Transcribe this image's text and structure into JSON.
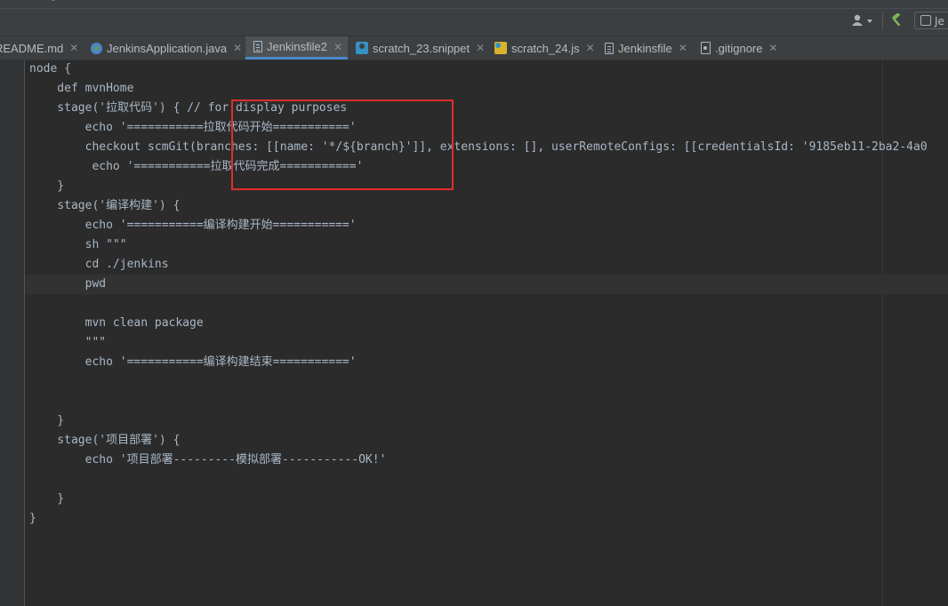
{
  "toolbar": {
    "user_icon": "user-icon",
    "build_icon": "hammer-icon",
    "run_config_label": "Je"
  },
  "tabs": [
    {
      "label": "README.md",
      "icon": "file-icon",
      "active": false
    },
    {
      "label": "JenkinsApplication.java",
      "icon": "spring-class-icon",
      "active": false
    },
    {
      "label": "Jenkinsfile2",
      "icon": "file-icon",
      "active": true
    },
    {
      "label": "scratch_23.snippet",
      "icon": "scratch-icon",
      "active": false
    },
    {
      "label": "scratch_24.js",
      "icon": "js-scratch-icon",
      "active": false
    },
    {
      "label": "Jenkinsfile",
      "icon": "file-icon",
      "active": false
    },
    {
      "label": ".gitignore",
      "icon": "gitignore-icon",
      "active": false
    }
  ],
  "code": {
    "lines": [
      "node {",
      "    def mvnHome",
      "    stage('拉取代码') { // for display purposes",
      "        echo '===========拉取代码开始==========='",
      "        checkout scmGit(branches: [[name: '*/${branch}']], extensions: [], userRemoteConfigs: [[credentialsId: '9185eb11-2ba2-4a0",
      "         echo '===========拉取代码完成==========='",
      "    }",
      "    stage('编译构建') {",
      "        echo '===========编译构建开始==========='",
      "        sh \"\"\"",
      "        cd ./jenkins",
      "        pwd",
      "",
      "        mvn clean package",
      "        \"\"\"",
      "        echo '===========编译构建结束==========='",
      "",
      "",
      "    }",
      "    stage('项目部署') {",
      "        echo '项目部署---------模拟部署-----------OK!'",
      "",
      "    }",
      "}"
    ],
    "current_line": 11
  },
  "colors": {
    "editor_bg": "#2b2b2b",
    "text": "#a9b7c6",
    "active_tab_underline": "#4a88c7",
    "highlight_box": "#e02d2d"
  }
}
